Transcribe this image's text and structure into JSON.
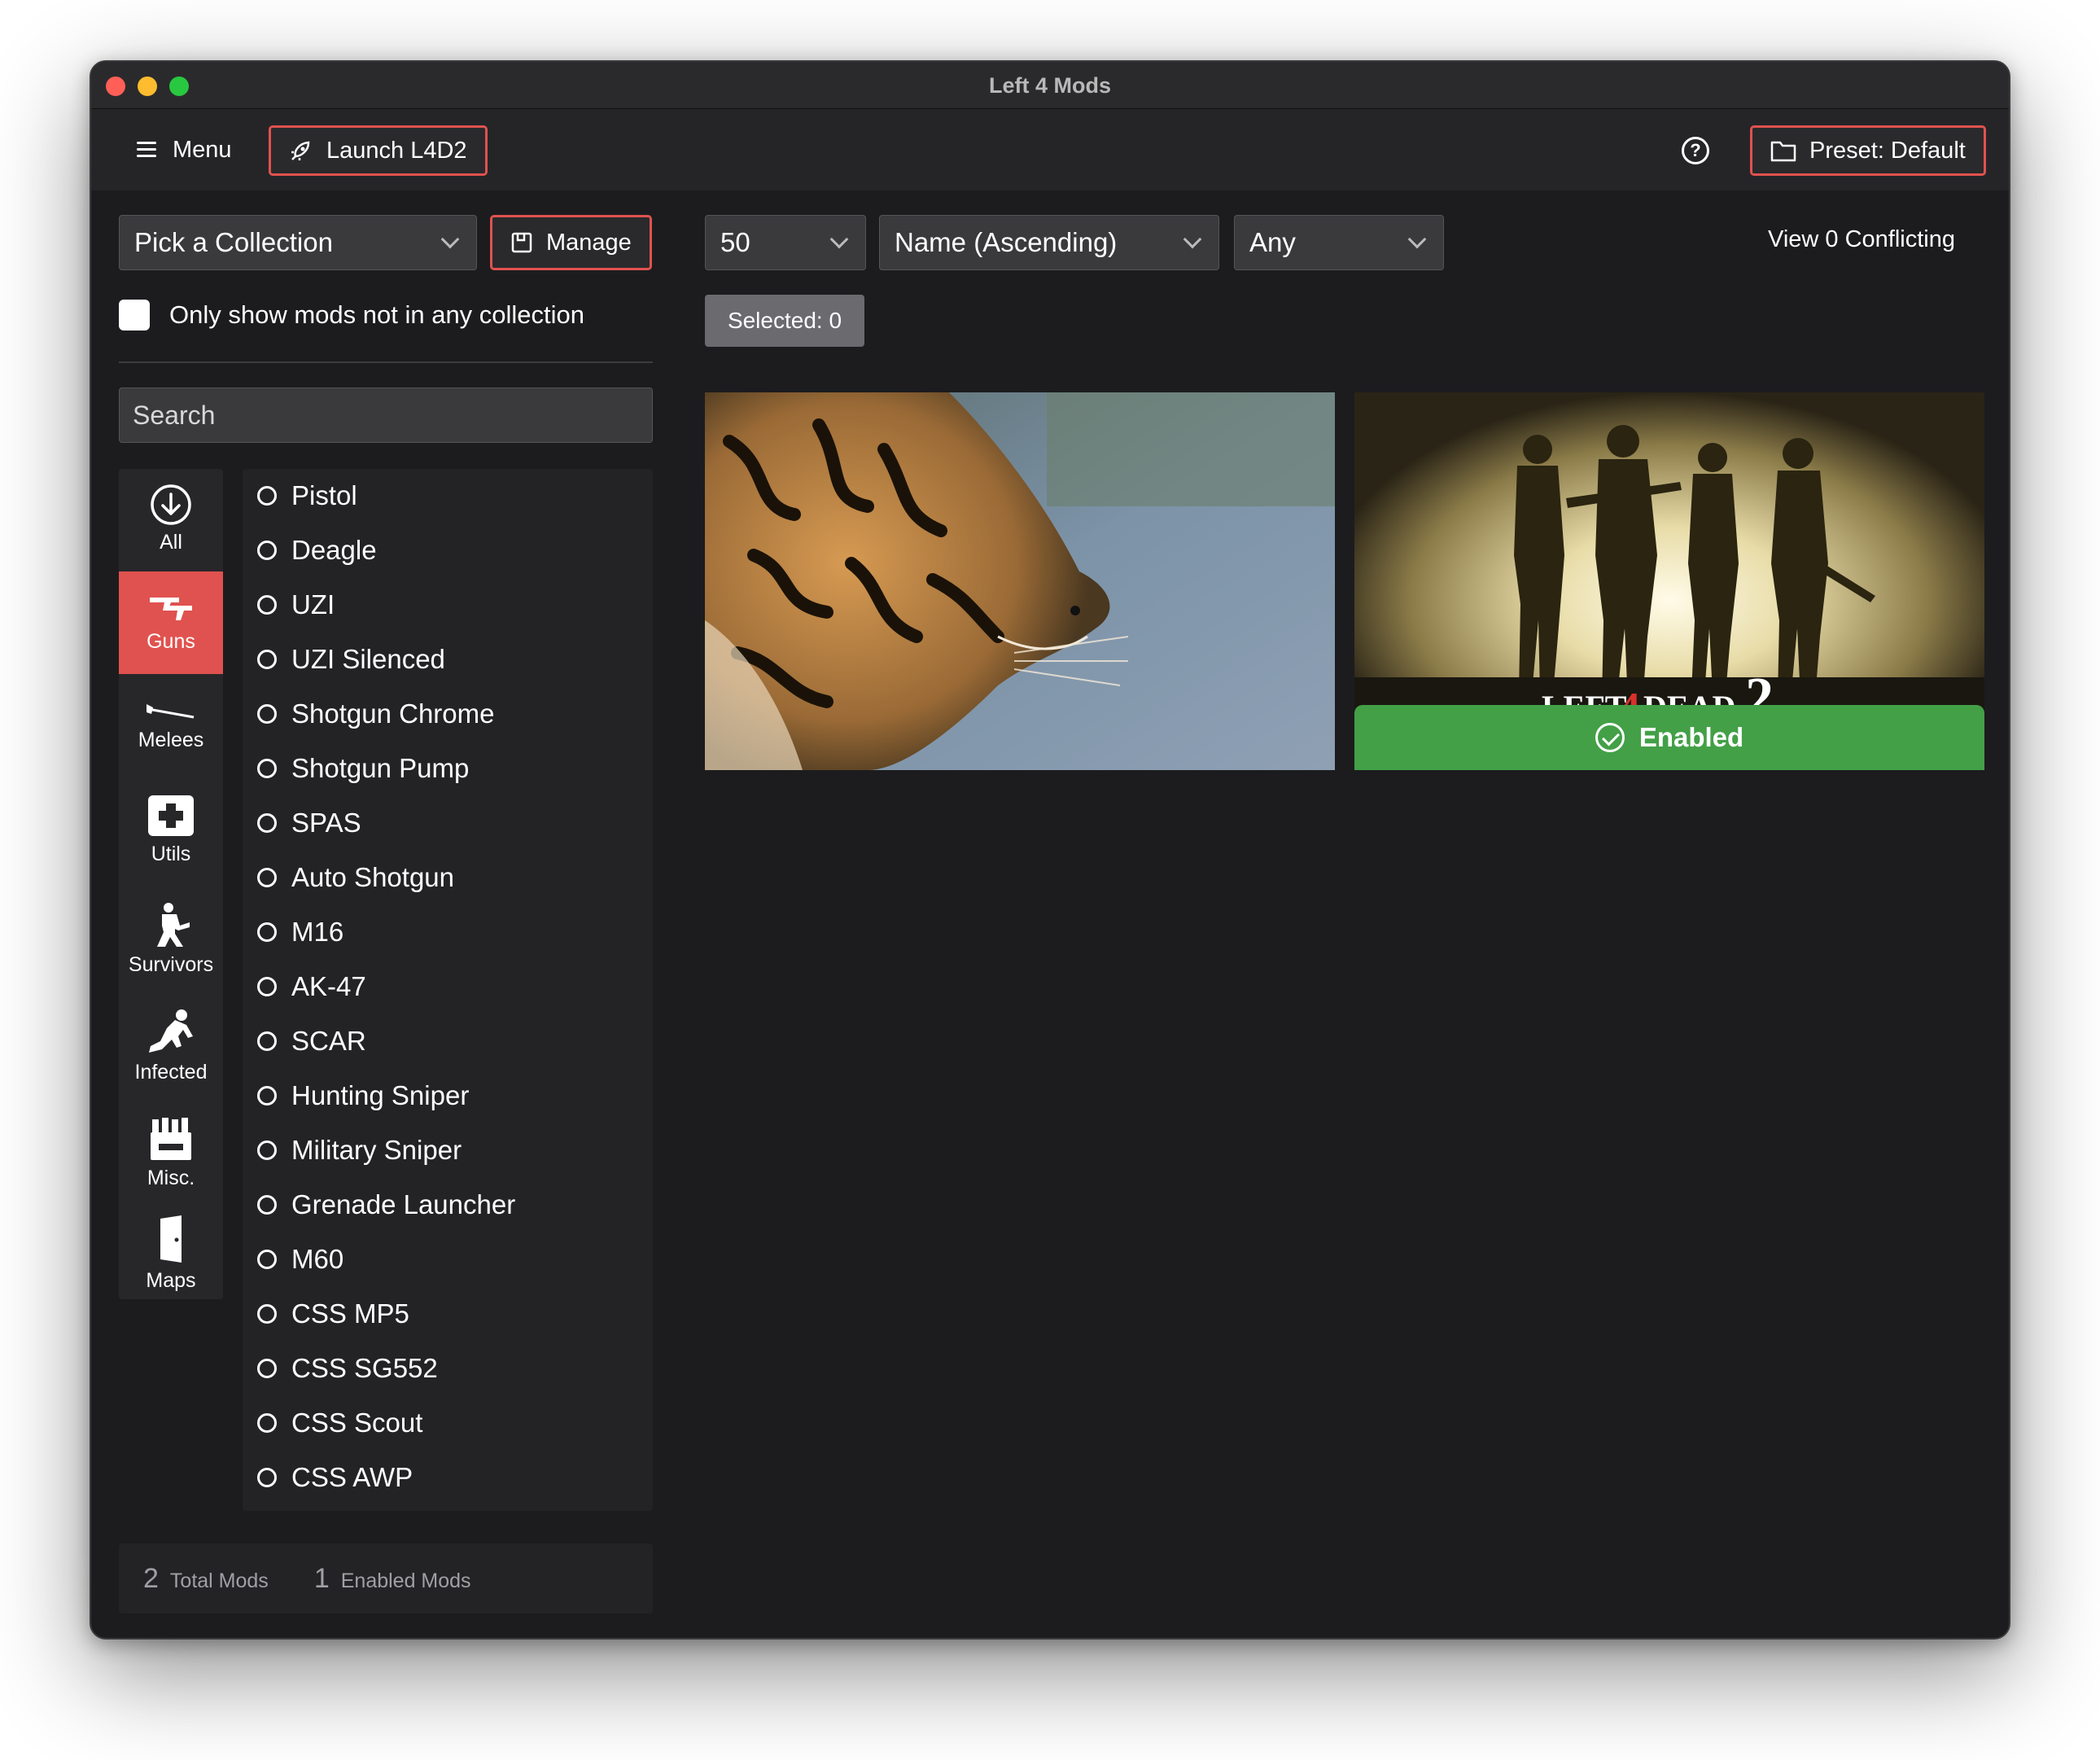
{
  "window": {
    "title": "Left 4 Mods"
  },
  "toolbar": {
    "menu_label": "Menu",
    "launch_label": "Launch L4D2",
    "help_icon": "help-circle-icon",
    "preset_label": "Preset: Default",
    "accent_color": "#e0524f"
  },
  "sidebar": {
    "collection_select": "Pick a Collection",
    "manage_label": "Manage",
    "only_unassigned_label": "Only show mods not in any collection",
    "only_unassigned_checked": false,
    "search_placeholder": "Search",
    "categories": [
      {
        "label": "All",
        "icon": "download-circle-icon",
        "active": false
      },
      {
        "label": "Guns",
        "icon": "guns-icon",
        "active": true
      },
      {
        "label": "Melees",
        "icon": "melee-icon",
        "active": false
      },
      {
        "label": "Utils",
        "icon": "medkit-icon",
        "active": false
      },
      {
        "label": "Survivors",
        "icon": "survivor-icon",
        "active": false
      },
      {
        "label": "Infected",
        "icon": "infected-icon",
        "active": false
      },
      {
        "label": "Misc.",
        "icon": "misc-icon",
        "active": false
      },
      {
        "label": "Maps",
        "icon": "door-icon",
        "active": false
      }
    ],
    "subcategories": [
      "Pistol",
      "Deagle",
      "UZI",
      "UZI Silenced",
      "Shotgun Chrome",
      "Shotgun Pump",
      "SPAS",
      "Auto Shotgun",
      "M16",
      "AK-47",
      "SCAR",
      "Hunting Sniper",
      "Military Sniper",
      "Grenade Launcher",
      "M60",
      "CSS MP5",
      "CSS SG552",
      "CSS Scout",
      "CSS AWP"
    ],
    "stats": {
      "total_count": "2",
      "total_label": "Total Mods",
      "enabled_count": "1",
      "enabled_label": "Enabled Mods"
    }
  },
  "main": {
    "per_page": "50",
    "sort": "Name (Ascending)",
    "filter": "Any",
    "selected_label": "Selected: 0",
    "conflicting_label": "View 0 Conflicting",
    "mods": [
      {
        "thumbnail": "tiger-photo",
        "status": ""
      },
      {
        "thumbnail": "left-4-dead-2-survivors-art",
        "status": "Enabled",
        "status_color": "#43a047"
      }
    ]
  }
}
